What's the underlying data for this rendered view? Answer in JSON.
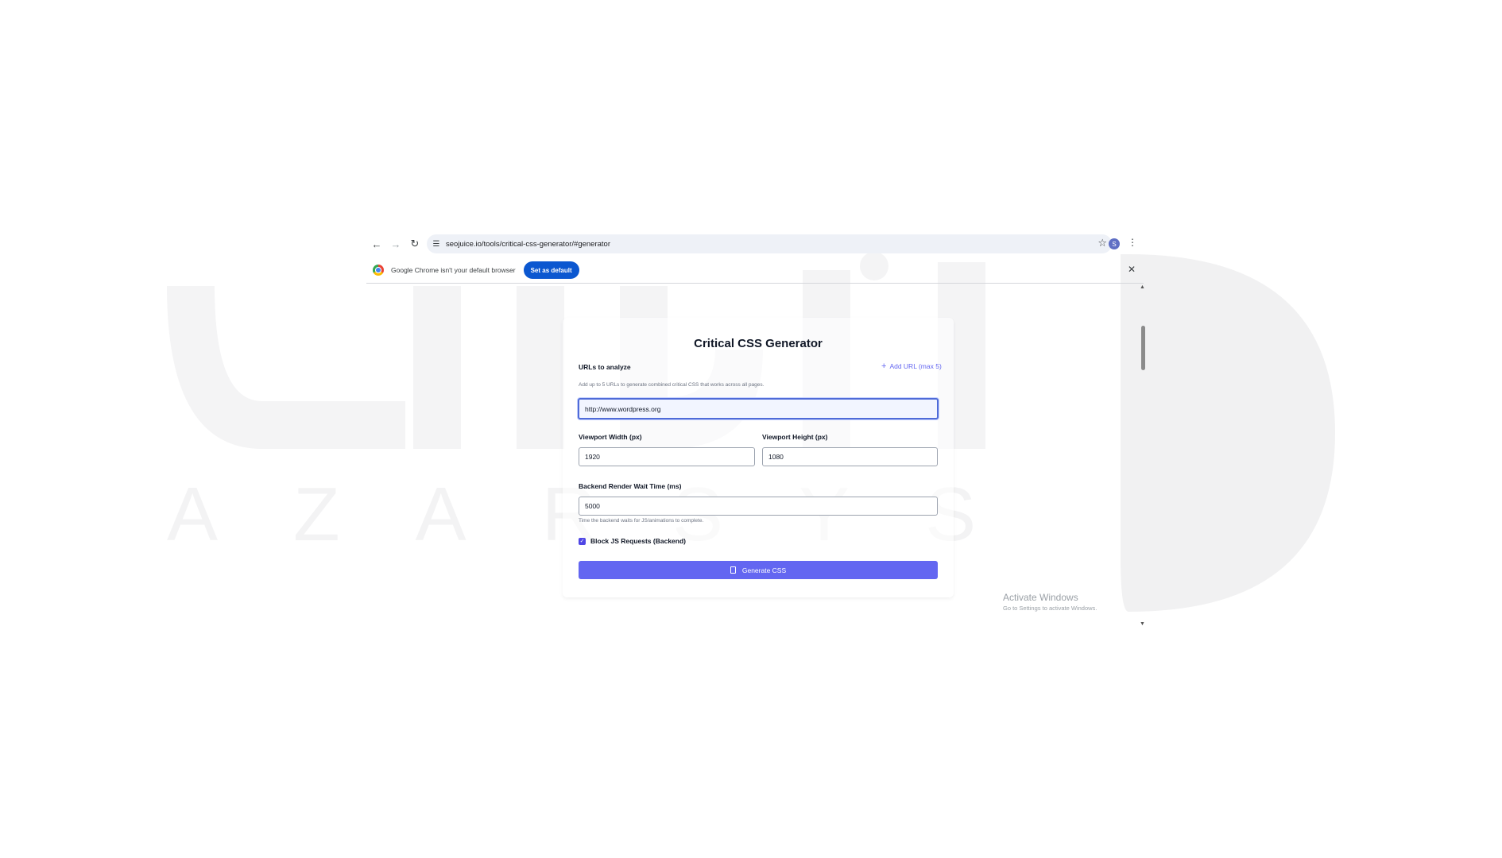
{
  "browser": {
    "url": "seojuice.io/tools/critical-css-generator/#generator",
    "profile_initial": "S",
    "infobar_message": "Google Chrome isn't your default browser",
    "set_default_label": "Set as default"
  },
  "page": {
    "title": "Critical CSS Generator",
    "urls_label": "URLs to analyze",
    "add_url_label": "Add URL (max 5)",
    "urls_help": "Add up to 5 URLs to generate combined critical CSS that works across all pages.",
    "url_value": "http://www.wordpress.org",
    "viewport_width_label": "Viewport Width (px)",
    "viewport_width_value": "1920",
    "viewport_height_label": "Viewport Height (px)",
    "viewport_height_value": "1080",
    "wait_label": "Backend Render Wait Time (ms)",
    "wait_value": "5000",
    "wait_help": "Time the backend waits for JS/animations to complete.",
    "block_js_label": "Block JS Requests (Backend)",
    "block_js_checked": true,
    "generate_label": "Generate CSS"
  },
  "os": {
    "activate_title": "Activate Windows",
    "activate_sub": "Go to Settings to activate Windows."
  },
  "colors": {
    "accent": "#6366f1",
    "chrome_blue": "#0b57d0"
  }
}
